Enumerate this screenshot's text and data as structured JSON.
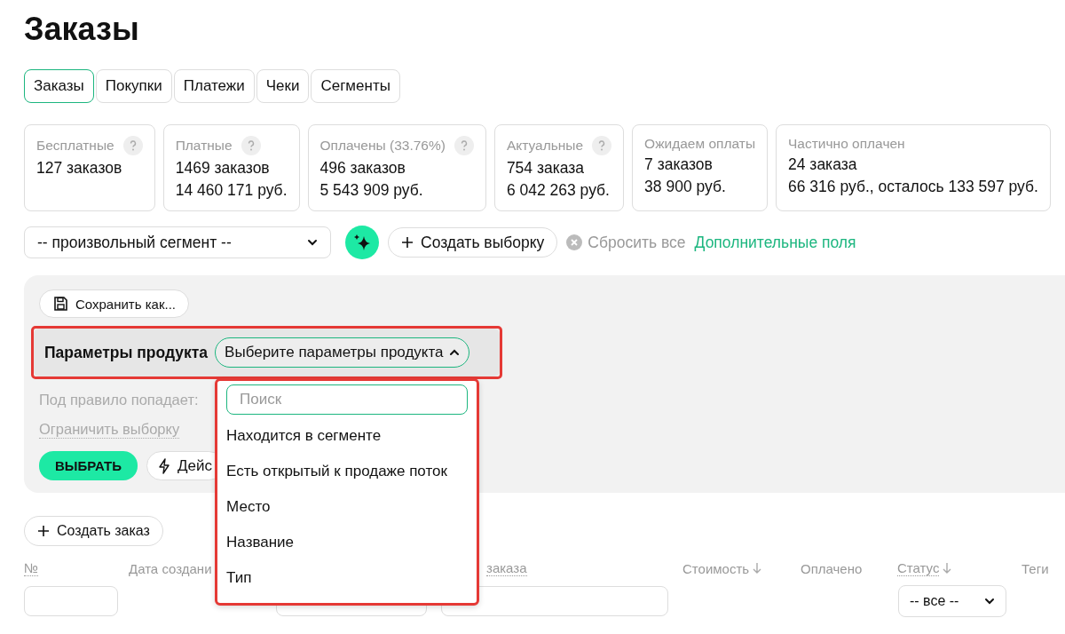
{
  "title": "Заказы",
  "tabs": [
    {
      "label": "Заказы",
      "selected": true
    },
    {
      "label": "Покупки",
      "selected": false
    },
    {
      "label": "Платежи",
      "selected": false
    },
    {
      "label": "Чеки",
      "selected": false
    },
    {
      "label": "Сегменты",
      "selected": false
    }
  ],
  "stats": [
    {
      "label": "Бесплатные",
      "help": true,
      "lines": [
        "127 заказов"
      ]
    },
    {
      "label": "Платные",
      "help": true,
      "lines": [
        "1469 заказов",
        "14 460 171 руб."
      ]
    },
    {
      "label": "Оплачены (33.76%)",
      "help": true,
      "lines": [
        "496 заказов",
        "5 543 909 руб."
      ]
    },
    {
      "label": "Актуальные",
      "help": true,
      "lines": [
        "754 заказа",
        "6 042 263 руб."
      ]
    },
    {
      "label": "Ожидаем оплаты",
      "help": false,
      "lines": [
        "7 заказов",
        "38 900 руб."
      ]
    },
    {
      "label": "Частично оплачен",
      "help": false,
      "lines": [
        "24 заказа",
        "66 316 руб., осталось 133 597 руб."
      ]
    }
  ],
  "segment_select": {
    "value": "-- произвольный сегмент --"
  },
  "create_selection_button": {
    "label": "Создать выборку"
  },
  "reset_button": {
    "label": "Сбросить все"
  },
  "extra_fields_link": {
    "label": "Дополнительные поля"
  },
  "filter_panel": {
    "save_button": {
      "label": "Сохранить как..."
    },
    "param": {
      "label": "Параметры продукта",
      "value": "Выберите параметры продукта",
      "expanded": true,
      "highlighted": true
    },
    "match_label": "Под правило попадает:",
    "limit_link": "Ограничить выборку",
    "select_button": {
      "label": "ВЫБРАТЬ"
    },
    "action_button": {
      "label": "Дейс"
    }
  },
  "dropdown": {
    "highlighted": true,
    "search": {
      "placeholder": "Поиск"
    },
    "options": [
      "Находится в сегменте",
      "Есть открытый к продаже поток",
      "Место",
      "Название",
      "Тип"
    ]
  },
  "create_order_button": {
    "label": "Создать заказ"
  },
  "table": {
    "columns": [
      {
        "label": "№",
        "underlined": true,
        "sortable": false
      },
      {
        "label": "Дата создани",
        "underlined": false,
        "sortable": false
      },
      {
        "label": "заказа",
        "underlined": true,
        "sortable": false
      },
      {
        "label": "Стоимость",
        "underlined": false,
        "sortable": true
      },
      {
        "label": "Оплачено",
        "underlined": false,
        "sortable": false
      },
      {
        "label": "Статус",
        "underlined": true,
        "sortable": true
      },
      {
        "label": "Теги",
        "underlined": false,
        "sortable": false
      }
    ],
    "filters": [
      {
        "kind": "input"
      },
      {
        "kind": "input"
      },
      {
        "kind": "input"
      },
      {
        "kind": "select",
        "value": "-- все --"
      }
    ]
  }
}
